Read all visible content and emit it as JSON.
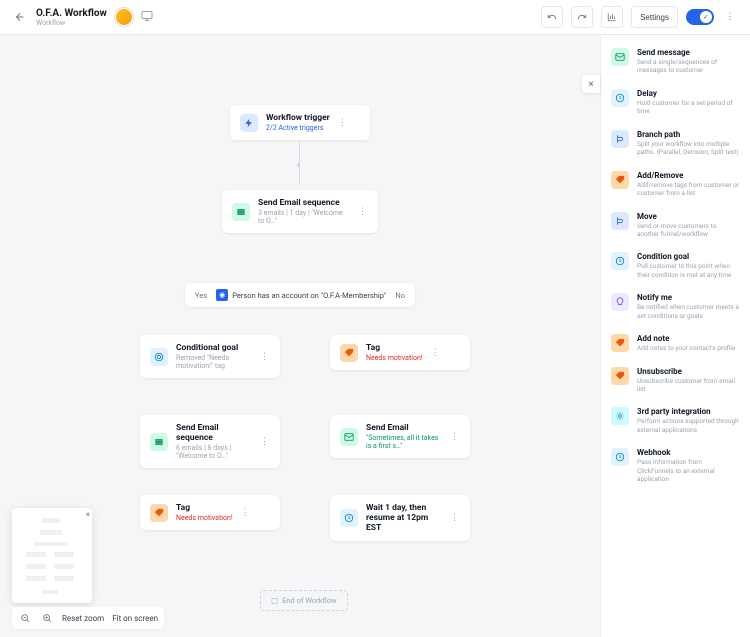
{
  "header": {
    "title": "O.F.A. Workflow",
    "subtitle": "Workflow",
    "settings_label": "Settings"
  },
  "nodes": {
    "trigger": {
      "title": "Workflow trigger",
      "sub": "2/2 Active triggers"
    },
    "seq1": {
      "title": "Send Email sequence",
      "sub": "3 emails | 1 day | \"Welcome to O…\""
    },
    "condition": {
      "yes": "Yes",
      "no": "No",
      "text": "Person has an account on \"O.F.A-Membership\""
    },
    "goal": {
      "title": "Conditional goal",
      "sub": "Removed \"Needs motivation!\" tag"
    },
    "tag1": {
      "title": "Tag",
      "sub": "Needs motivation!"
    },
    "seq2": {
      "title": "Send Email sequence",
      "sub": "6 emails | 6 days | \"Welcome to O…\""
    },
    "send1": {
      "title": "Send Email",
      "sub": "\"Sometimes, all it takes is a first s…\""
    },
    "tag2": {
      "title": "Tag",
      "sub": "Needs motivation!"
    },
    "wait": {
      "title": "Wait 1 day, then resume at 12pm EST"
    },
    "end": {
      "label": "End of Workflow"
    }
  },
  "actions": [
    {
      "title": "Send message",
      "desc": "Send a single/sequences of messages to customer",
      "color": "ic-green"
    },
    {
      "title": "Delay",
      "desc": "Hold customer for a set period of time",
      "color": "ic-sky"
    },
    {
      "title": "Branch path",
      "desc": "Split your workflow into multiple paths. (Parallel, Decision, Split test)",
      "color": "ic-blue"
    },
    {
      "title": "Add/Remove",
      "desc": "Add/remove tags from customer or customer from a list",
      "color": "ic-orange"
    },
    {
      "title": "Move",
      "desc": "Send or move customers to another funnel/workflow",
      "color": "ic-blue"
    },
    {
      "title": "Condition goal",
      "desc": "Pull customer to this point when their condition is met at any time",
      "color": "ic-sky"
    },
    {
      "title": "Notify me",
      "desc": "Be notified when customer meets a set conditions or goals",
      "color": "ic-purple"
    },
    {
      "title": "Add note",
      "desc": "Add notes to your contact's profile",
      "color": "ic-orange"
    },
    {
      "title": "Unsubscribe",
      "desc": "Unsubscribe customer from email list",
      "color": "ic-orange"
    },
    {
      "title": "3rd party integration",
      "desc": "Perform actions supported through external applications",
      "color": "ic-cyan"
    },
    {
      "title": "Webhook",
      "desc": "Pass information from ClickFunnels to an external application",
      "color": "ic-sky"
    }
  ],
  "zoom": {
    "reset": "Reset zoom",
    "fit": "Fit on screen"
  }
}
